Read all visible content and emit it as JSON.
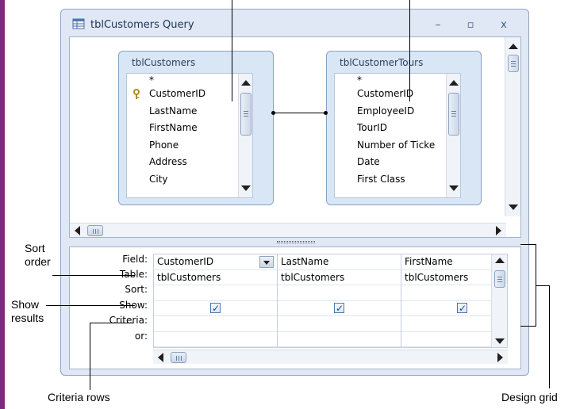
{
  "window": {
    "title": "tblCustomers Query",
    "controls": {
      "minimize": "–",
      "maximize": "▫",
      "close": "x"
    }
  },
  "tables": [
    {
      "title": "tblCustomers",
      "fields": [
        "*",
        "CustomerID",
        "LastName",
        "FirstName",
        "Phone",
        "Address",
        "City"
      ],
      "primary_key": "CustomerID"
    },
    {
      "title": "tblCustomerTours",
      "fields": [
        "*",
        "CustomerID",
        "EmployeeID",
        "TourID",
        "Number of Ticke",
        "Date",
        "First Class"
      ]
    }
  ],
  "grid": {
    "row_labels": [
      "Field:",
      "Table:",
      "Sort:",
      "Show:",
      "Criteria:",
      "or:"
    ],
    "columns": [
      {
        "field": "CustomerID",
        "table": "tblCustomers",
        "show": true
      },
      {
        "field": "LastName",
        "table": "tblCustomers",
        "show": true
      },
      {
        "field": "FirstName",
        "table": "tblCustomers",
        "show": true
      }
    ]
  },
  "callouts": {
    "sort_order": "Sort\norder",
    "show_results": "Show\nresults",
    "criteria_rows": "Criteria rows",
    "design_grid": "Design grid"
  },
  "colors": {
    "accent_bar": "#7b2a7e",
    "window_bg": "#dfe8f4",
    "table_box": "#d9e6f6"
  }
}
